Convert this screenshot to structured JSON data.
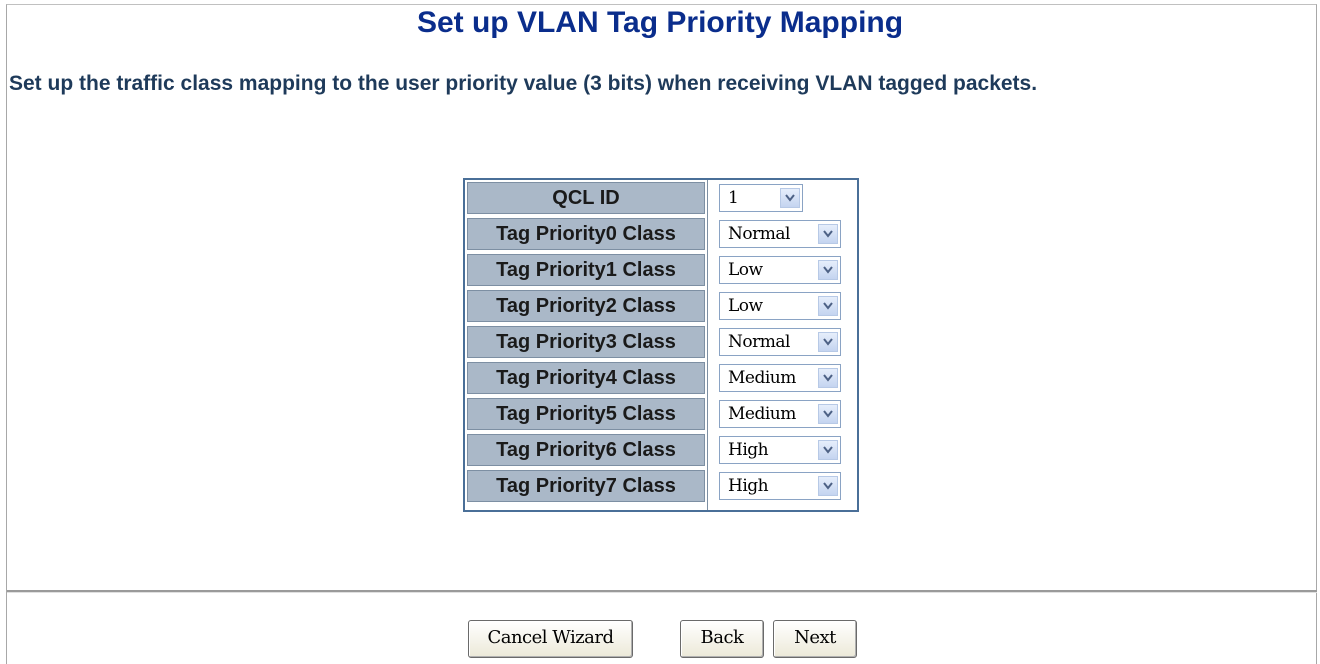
{
  "page": {
    "title": "Set up VLAN Tag Priority Mapping",
    "subtitle": "Set up the traffic class mapping to the user priority value (3 bits) when receiving VLAN tagged packets."
  },
  "qcl": {
    "label": "QCL ID",
    "value": "1"
  },
  "priorities": [
    {
      "label": "Tag Priority0 Class",
      "value": "Normal"
    },
    {
      "label": "Tag Priority1 Class",
      "value": "Low"
    },
    {
      "label": "Tag Priority2 Class",
      "value": "Low"
    },
    {
      "label": "Tag Priority3 Class",
      "value": "Normal"
    },
    {
      "label": "Tag Priority4 Class",
      "value": "Medium"
    },
    {
      "label": "Tag Priority5 Class",
      "value": "Medium"
    },
    {
      "label": "Tag Priority6 Class",
      "value": "High"
    },
    {
      "label": "Tag Priority7 Class",
      "value": "High"
    }
  ],
  "buttons": {
    "cancel": "Cancel Wizard",
    "back": "Back",
    "next": "Next"
  },
  "colors": {
    "title": "#0a2d8c",
    "label_cell": "#aab8c8",
    "table_border": "#4a6f98"
  },
  "icons": {
    "dropdown": "chevron-down-icon"
  }
}
